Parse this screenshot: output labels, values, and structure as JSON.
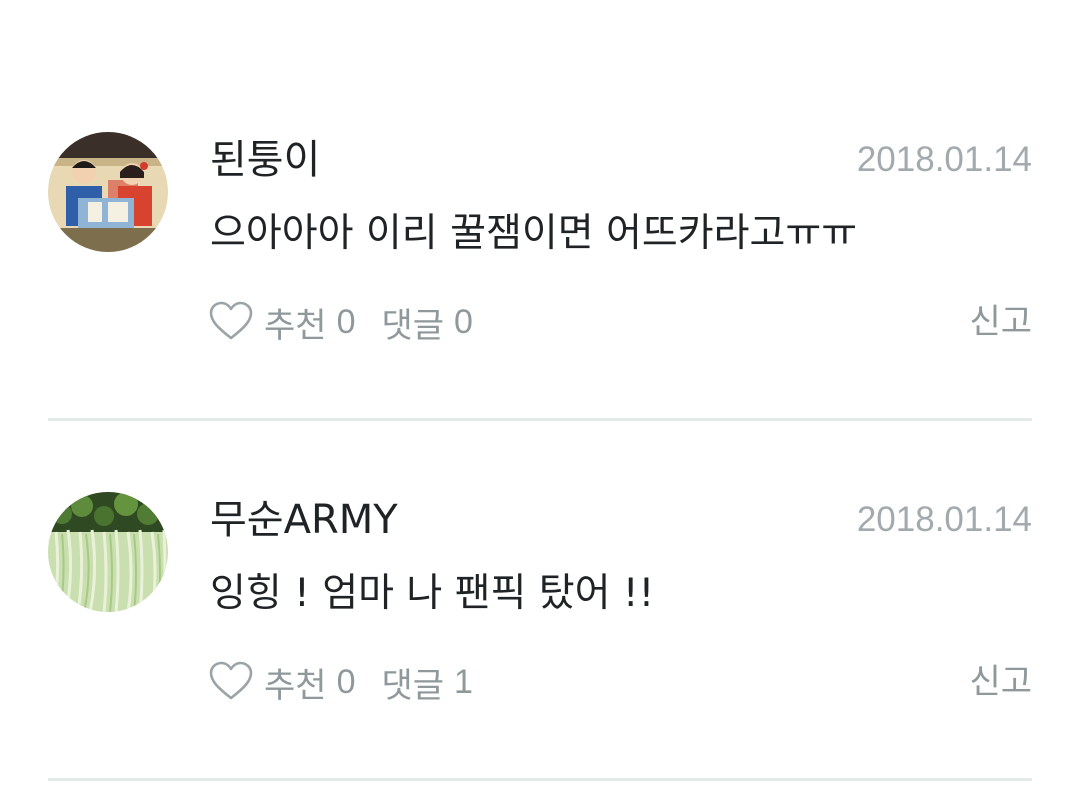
{
  "comments": [
    {
      "author": "된퉁이",
      "date": "2018.01.14",
      "text": "으아아아 이리 꿀잼이면 어뜨카라고ㅠㅠ",
      "avatar_icon": "avatar-illustration-kids-reading",
      "recommend_label": "추천",
      "recommend_count": "0",
      "reply_label": "댓글",
      "reply_count": "0",
      "report_label": "신고"
    },
    {
      "author": "무순ARMY",
      "date": "2018.01.14",
      "text": "잉힝 ! 엄마 나 팬픽 탔어 !!",
      "avatar_icon": "avatar-sprouts-photo",
      "recommend_label": "추천",
      "recommend_count": "0",
      "reply_label": "댓글",
      "reply_count": "1",
      "report_label": "신고"
    }
  ],
  "colors": {
    "text_primary": "#1f2326",
    "text_muted": "#8f989b",
    "date": "#a2aaad",
    "divider": "#e3ebe8"
  }
}
